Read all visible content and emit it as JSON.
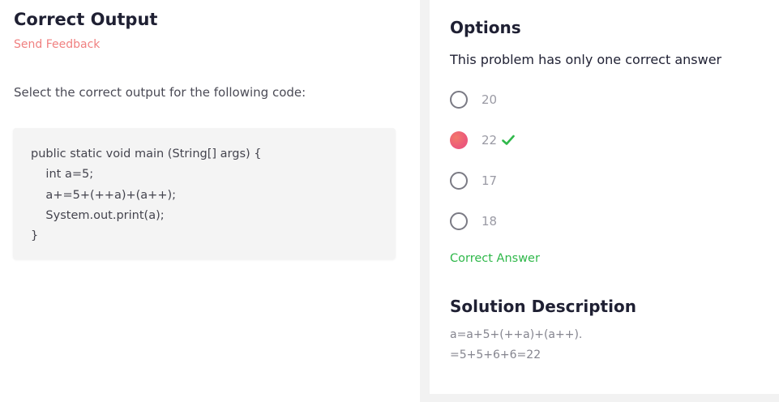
{
  "question_panel": {
    "title": "Correct Output",
    "feedback_link": "Send Feedback",
    "prompt": "Select the correct output for the following code:",
    "code_lines": [
      "public static void main (String[] args) {",
      "    int a=5;",
      "    a+=5+(++a)+(a++);",
      "    System.out.print(a);",
      "}"
    ]
  },
  "options_panel": {
    "title": "Options",
    "subtitle": "This problem has only one correct answer",
    "options": [
      {
        "label": "20",
        "selected": false,
        "correct": false
      },
      {
        "label": "22",
        "selected": true,
        "correct": true
      },
      {
        "label": "17",
        "selected": false,
        "correct": false
      },
      {
        "label": "18",
        "selected": false,
        "correct": false
      }
    ],
    "result_text": "Correct Answer",
    "solution_title": "Solution Description",
    "solution_lines": [
      "a=a+5+(++a)+(a++).",
      "=5+5+6+6=22"
    ]
  },
  "colors": {
    "accent_feedback": "#f08080",
    "correct_green": "#2fb84a",
    "selected_radio": "#ec5a7a",
    "divider": "#f2f2f2"
  },
  "icons": {
    "check": "check-icon"
  }
}
